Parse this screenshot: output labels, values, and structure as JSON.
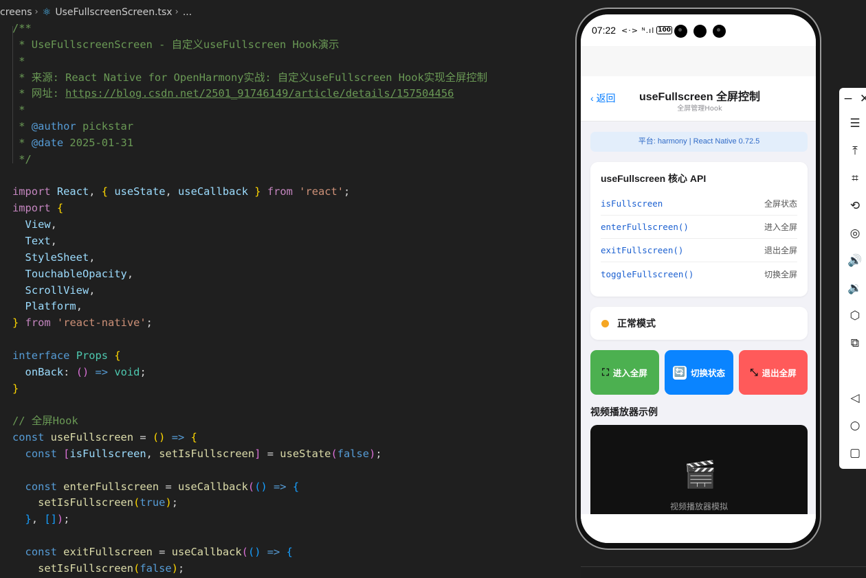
{
  "editor": {
    "breadcrumb": {
      "folder": "creens",
      "file": "UseFullscreenScreen.tsx",
      "more": "..."
    },
    "lines": [
      [
        [
          "c",
          "/**"
        ]
      ],
      [
        [
          "c",
          " * UseFullscreenScreen - 自定义useFullscreen Hook演示"
        ]
      ],
      [
        [
          "c",
          " *"
        ]
      ],
      [
        [
          "c",
          " * 来源: React Native for OpenHarmony实战: 自定义useFullscreen Hook实现全屏控制"
        ]
      ],
      [
        [
          "c",
          " * 网址: "
        ],
        [
          "u",
          "https://blog.csdn.net/2501_91746149/article/details/157504456"
        ]
      ],
      [
        [
          "c",
          " *"
        ]
      ],
      [
        [
          "c",
          " * "
        ],
        [
          "dc",
          "@author"
        ],
        [
          "c",
          " pickstar"
        ]
      ],
      [
        [
          "c",
          " * "
        ],
        [
          "dc",
          "@date"
        ],
        [
          "c",
          " 2025-01-31"
        ]
      ],
      [
        [
          "c",
          " */"
        ]
      ],
      [],
      [
        [
          "kw",
          "import"
        ],
        [
          "p",
          " "
        ],
        [
          "vr",
          "React"
        ],
        [
          "p",
          ", "
        ],
        [
          "br1",
          "{"
        ],
        [
          "p",
          " "
        ],
        [
          "vr",
          "useState"
        ],
        [
          "p",
          ", "
        ],
        [
          "vr",
          "useCallback"
        ],
        [
          "p",
          " "
        ],
        [
          "br1",
          "}"
        ],
        [
          "p",
          " "
        ],
        [
          "kw",
          "from"
        ],
        [
          "p",
          " "
        ],
        [
          "st",
          "'react'"
        ],
        [
          "p",
          ";"
        ]
      ],
      [
        [
          "kw",
          "import"
        ],
        [
          "p",
          " "
        ],
        [
          "br1",
          "{"
        ]
      ],
      [
        [
          "p",
          "  "
        ],
        [
          "vr",
          "View"
        ],
        [
          "p",
          ","
        ]
      ],
      [
        [
          "p",
          "  "
        ],
        [
          "vr",
          "Text"
        ],
        [
          "p",
          ","
        ]
      ],
      [
        [
          "p",
          "  "
        ],
        [
          "vr",
          "StyleSheet"
        ],
        [
          "p",
          ","
        ]
      ],
      [
        [
          "p",
          "  "
        ],
        [
          "vr",
          "TouchableOpacity"
        ],
        [
          "p",
          ","
        ]
      ],
      [
        [
          "p",
          "  "
        ],
        [
          "vr",
          "ScrollView"
        ],
        [
          "p",
          ","
        ]
      ],
      [
        [
          "p",
          "  "
        ],
        [
          "vr",
          "Platform"
        ],
        [
          "p",
          ","
        ]
      ],
      [
        [
          "br1",
          "}"
        ],
        [
          "p",
          " "
        ],
        [
          "kw",
          "from"
        ],
        [
          "p",
          " "
        ],
        [
          "st",
          "'react-native'"
        ],
        [
          "p",
          ";"
        ]
      ],
      [],
      [
        [
          "kb",
          "interface"
        ],
        [
          "p",
          " "
        ],
        [
          "ty",
          "Props"
        ],
        [
          "p",
          " "
        ],
        [
          "br1",
          "{"
        ]
      ],
      [
        [
          "p",
          "  "
        ],
        [
          "vr",
          "onBack"
        ],
        [
          "p",
          ": "
        ],
        [
          "br2",
          "()"
        ],
        [
          "p",
          " "
        ],
        [
          "kb",
          "=>"
        ],
        [
          "p",
          " "
        ],
        [
          "ty",
          "void"
        ],
        [
          "p",
          ";"
        ]
      ],
      [
        [
          "br1",
          "}"
        ]
      ],
      [],
      [
        [
          "c",
          "// 全屏Hook"
        ]
      ],
      [
        [
          "kb",
          "const"
        ],
        [
          "p",
          " "
        ],
        [
          "fn",
          "useFullscreen"
        ],
        [
          "p",
          " = "
        ],
        [
          "br1",
          "()"
        ],
        [
          "p",
          " "
        ],
        [
          "kb",
          "=>"
        ],
        [
          "p",
          " "
        ],
        [
          "br1",
          "{"
        ]
      ],
      [
        [
          "p",
          "  "
        ],
        [
          "kb",
          "const"
        ],
        [
          "p",
          " "
        ],
        [
          "br2",
          "["
        ],
        [
          "vr",
          "isFullscreen"
        ],
        [
          "p",
          ", "
        ],
        [
          "fn",
          "setIsFullscreen"
        ],
        [
          "br2",
          "]"
        ],
        [
          "p",
          " = "
        ],
        [
          "fn",
          "useState"
        ],
        [
          "br2",
          "("
        ],
        [
          "kb",
          "false"
        ],
        [
          "br2",
          ")"
        ],
        [
          "p",
          ";"
        ]
      ],
      [],
      [
        [
          "p",
          "  "
        ],
        [
          "kb",
          "const"
        ],
        [
          "p",
          " "
        ],
        [
          "fn",
          "enterFullscreen"
        ],
        [
          "p",
          " = "
        ],
        [
          "fn",
          "useCallback"
        ],
        [
          "br2",
          "("
        ],
        [
          "br3",
          "()"
        ],
        [
          "p",
          " "
        ],
        [
          "kb",
          "=>"
        ],
        [
          "p",
          " "
        ],
        [
          "br3",
          "{"
        ]
      ],
      [
        [
          "p",
          "    "
        ],
        [
          "fn",
          "setIsFullscreen"
        ],
        [
          "br1",
          "("
        ],
        [
          "kb",
          "true"
        ],
        [
          "br1",
          ")"
        ],
        [
          "p",
          ";"
        ]
      ],
      [
        [
          "p",
          "  "
        ],
        [
          "br3",
          "}"
        ],
        [
          "p",
          ", "
        ],
        [
          "br3",
          "[]"
        ],
        [
          "br2",
          ")"
        ],
        [
          "p",
          ";"
        ]
      ],
      [],
      [
        [
          "p",
          "  "
        ],
        [
          "kb",
          "const"
        ],
        [
          "p",
          " "
        ],
        [
          "fn",
          "exitFullscreen"
        ],
        [
          "p",
          " = "
        ],
        [
          "fn",
          "useCallback"
        ],
        [
          "br2",
          "("
        ],
        [
          "br3",
          "()"
        ],
        [
          "p",
          " "
        ],
        [
          "kb",
          "=>"
        ],
        [
          "p",
          " "
        ],
        [
          "br3",
          "{"
        ]
      ],
      [
        [
          "p",
          "    "
        ],
        [
          "fn",
          "setIsFullscreen"
        ],
        [
          "br1",
          "("
        ],
        [
          "kb",
          "false"
        ],
        [
          "br1",
          ")"
        ],
        [
          "p",
          ";"
        ]
      ]
    ]
  },
  "phone": {
    "status": {
      "time": "07:22",
      "icons": "<·> ᴺ.ıl",
      "battery": "100"
    },
    "header": {
      "back": "‹ 返回",
      "title": "useFullscreen 全屏控制",
      "subtitle": "全屏管理Hook"
    },
    "platform": "平台: harmony | React Native 0.72.5",
    "api_card": {
      "title": "useFullscreen 核心 API",
      "rows": [
        {
          "name": "isFullscreen",
          "desc": "全屏状态"
        },
        {
          "name": "enterFullscreen()",
          "desc": "进入全屏"
        },
        {
          "name": "exitFullscreen()",
          "desc": "退出全屏"
        },
        {
          "name": "toggleFullscreen()",
          "desc": "切换全屏"
        }
      ]
    },
    "mode": {
      "label": "正常模式",
      "dot_color": "#f5a623"
    },
    "buttons": {
      "enter": {
        "icon": "⛶",
        "label": "进入全屏",
        "color": "#4cb050"
      },
      "toggle": {
        "icon": "🔄",
        "label": "切换状态",
        "color": "#0a84ff"
      },
      "exit": {
        "icon": "⤡",
        "label": "退出全屏",
        "color": "#ff5a5a"
      }
    },
    "video_section": {
      "title": "视频播放器示例",
      "placeholder_icon": "🎬",
      "placeholder_text": "视频播放器模拟"
    }
  },
  "toolbar": {
    "items": [
      {
        "name": "minimize-icon",
        "glyph": "−"
      },
      {
        "name": "close-icon",
        "glyph": "✕"
      },
      {
        "name": "menu-icon",
        "glyph": "☰"
      },
      {
        "name": "pin-top-icon",
        "glyph": "⤒"
      },
      {
        "name": "crop-icon",
        "glyph": "⌗"
      },
      {
        "name": "rotate-icon",
        "glyph": "⟲"
      },
      {
        "name": "screen-record-icon",
        "glyph": "◎"
      },
      {
        "name": "volume-up-icon",
        "glyph": "🔊"
      },
      {
        "name": "volume-down-icon",
        "glyph": "🔉"
      },
      {
        "name": "shake-icon",
        "glyph": "⬡"
      },
      {
        "name": "screenshot-icon",
        "glyph": "⧉"
      },
      {
        "name": "nav-back-icon",
        "glyph": "◁"
      },
      {
        "name": "nav-home-icon",
        "glyph": "○"
      },
      {
        "name": "nav-recent-icon",
        "glyph": "▢"
      }
    ]
  }
}
